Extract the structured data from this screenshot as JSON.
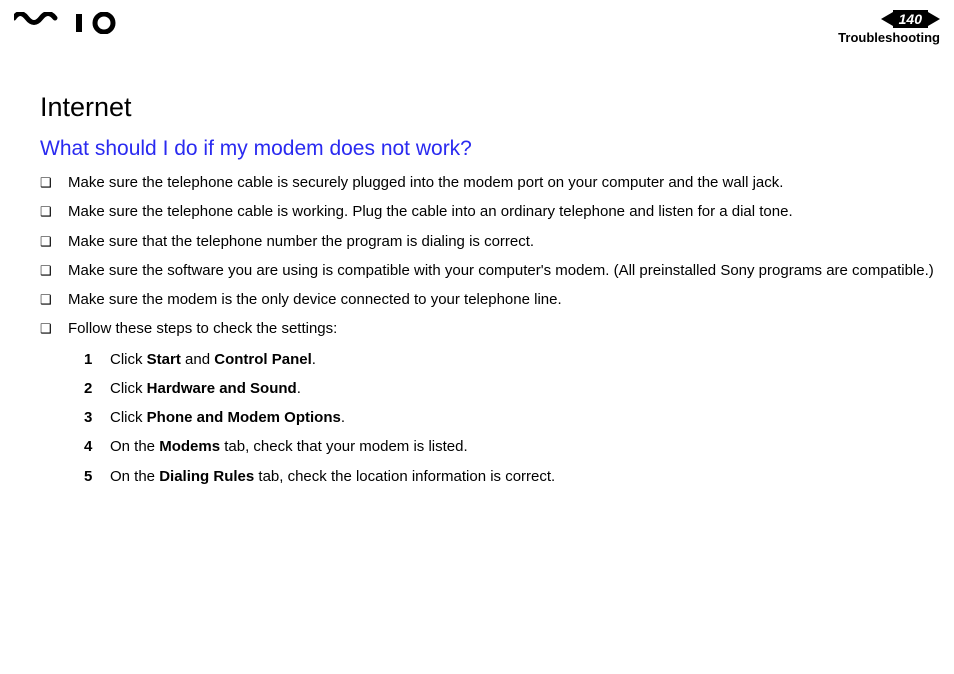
{
  "header": {
    "page_number": "140",
    "section": "Troubleshooting"
  },
  "content": {
    "title": "Internet",
    "subheading": "What should I do if my modem does not work?",
    "bullets": [
      "Make sure the telephone cable is securely plugged into the modem port on your computer and the wall jack.",
      "Make sure the telephone cable is working. Plug the cable into an ordinary telephone and listen for a dial tone.",
      "Make sure that the telephone number the program is dialing is correct.",
      "Make sure the software you are using is compatible with your computer's modem. (All preinstalled Sony programs are compatible.)",
      "Make sure the modem is the only device connected to your telephone line.",
      "Follow these steps to check the settings:"
    ],
    "steps": [
      {
        "pre": "Click ",
        "bold1": "Start",
        "mid": " and ",
        "bold2": "Control Panel",
        "post": "."
      },
      {
        "pre": "Click ",
        "bold1": "Hardware and Sound",
        "mid": "",
        "bold2": "",
        "post": "."
      },
      {
        "pre": "Click ",
        "bold1": "Phone and Modem Options",
        "mid": "",
        "bold2": "",
        "post": "."
      },
      {
        "pre": "On the ",
        "bold1": "Modems",
        "mid": " tab, check that your modem is listed.",
        "bold2": "",
        "post": ""
      },
      {
        "pre": "On the ",
        "bold1": "Dialing Rules",
        "mid": " tab, check the location information is correct.",
        "bold2": "",
        "post": ""
      }
    ]
  }
}
